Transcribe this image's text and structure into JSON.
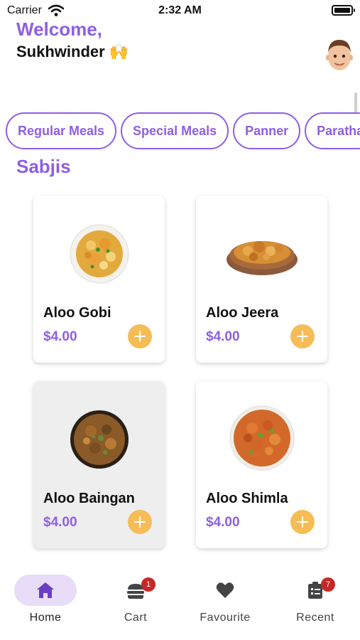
{
  "status_bar": {
    "carrier": "Carrier",
    "time": "2:32 AM"
  },
  "header": {
    "welcome": "Welcome,",
    "username": "Sukhwinder 🙌"
  },
  "categories": [
    "Regular Meals",
    "Special Meals",
    "Panner",
    "Paratha"
  ],
  "section_title": "Sabjis",
  "items": [
    {
      "name": "Aloo Gobi",
      "price": "$4.00"
    },
    {
      "name": "Aloo Jeera",
      "price": "$4.00"
    },
    {
      "name": "Aloo Baingan",
      "price": "$4.00"
    },
    {
      "name": "Aloo Shimla",
      "price": "$4.00"
    }
  ],
  "tabs": [
    {
      "label": "Home",
      "icon": "home-icon"
    },
    {
      "label": "Cart",
      "icon": "cart-icon",
      "badge": "1"
    },
    {
      "label": "Favourite",
      "icon": "heart-icon"
    },
    {
      "label": "Recent",
      "icon": "clipboard-list-icon",
      "badge": "7"
    }
  ],
  "colors": {
    "accent": "#8e5ee6",
    "add_button": "#f6bc55",
    "badge": "#c62828",
    "active_tab_bg": "#e8dcf9"
  }
}
